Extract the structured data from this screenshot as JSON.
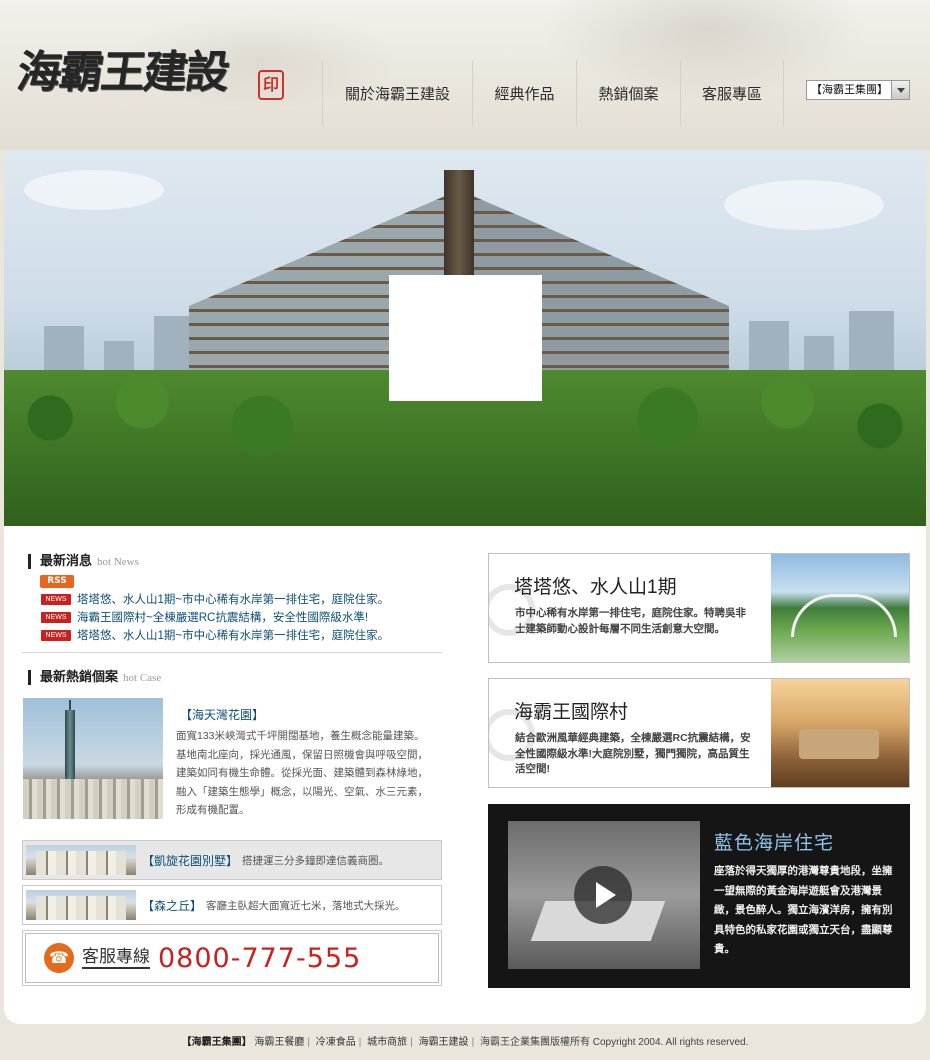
{
  "header": {
    "logo_text": "海霸王建設",
    "logo_seal": "印",
    "nav": [
      {
        "label": "關於海霸王建設"
      },
      {
        "label": "經典作品"
      },
      {
        "label": "熱銷個案"
      },
      {
        "label": "客服專區"
      }
    ],
    "group_select": "【海霸王集團】"
  },
  "news": {
    "title": "最新消息",
    "title_en": "hot News",
    "rss": "RSS",
    "badge": "NEWS",
    "items": [
      "塔塔悠、水人山1期~市中心稀有水岸第一排住宅，庭院住家。",
      "海霸王國際村~全棟嚴選RC抗震結構，安全性國際級水準!",
      "塔塔悠、水人山1期~市中心稀有水岸第一排住宅，庭院住家。"
    ]
  },
  "hot_case": {
    "title": "最新熱銷個案",
    "title_en": "hot Case",
    "featured_title": "【海天灣花園】",
    "featured_desc": "面寬133米峽灣式千坪開闊基地，養生概念能量建築。基地南北座向，採光通風，保留日照機會與呼吸空間，建築如同有機生命體。從採光面、建築體到森林綠地，融入「建築生態學」概念，以陽光、空氣、水三元素，形成有機配置。",
    "list": [
      {
        "title": "【凱旋花園別墅】",
        "desc": "搭捷運三分多鐘即達信義商圈。"
      },
      {
        "title": "【森之丘】",
        "desc": "客廳主臥超大面寬近七米，落地式大採光。"
      }
    ]
  },
  "hotline": {
    "label": "客服專線",
    "number": "0800-777-555"
  },
  "promos": [
    {
      "title": "塔塔悠、水人山1期",
      "desc": "市中心稀有水岸第一排住宅，庭院住家。特聘吳非士建築師動心設計每層不同生活創意大空間。"
    },
    {
      "title": "海霸王國際村",
      "desc": "結合歐洲風華經典建築，全棟嚴選RC抗震結構，安全性國際級水準!大庭院別墅，獨門獨院，高品質生活空間!"
    }
  ],
  "video": {
    "title": "藍色海岸住宅",
    "desc": "座落於得天獨厚的港灣尊貴地段，坐擁一望無際的黃金海岸遊艇會及港灣景緻，景色醉人。獨立海濱洋房，擁有別具特色的私家花園或獨立天台，盡顯尊貴。"
  },
  "footer": {
    "brand": "【海霸王集團】",
    "links": [
      "海霸王餐廳",
      "冷凍食品",
      "城市商旅",
      "海霸王建設"
    ],
    "copyright": "海霸王企業集團版權所有 Copyright 2004. All rights reserved."
  },
  "colors": {
    "accent_red": "#c8211f",
    "link_blue": "#0b5078",
    "video_title": "#8fc3e8"
  }
}
